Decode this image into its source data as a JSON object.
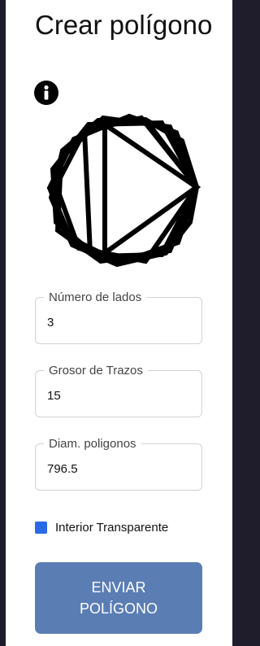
{
  "header": {
    "title": "Crear polígono",
    "info_icon": "info-circle-icon"
  },
  "form": {
    "sides": {
      "label": "Número de lados",
      "value": "3"
    },
    "stroke_width": {
      "label": "Grosor de Trazos",
      "value": "15"
    },
    "diameter": {
      "label": "Diam. poligonos",
      "value": "796.5"
    },
    "transparent_interior": {
      "label": "Interior Transparente",
      "checked": true
    },
    "submit_label": "ENVIAR POLÍGONO"
  },
  "colors": {
    "panel_background": "#ffffff",
    "page_background": "#1f1d2b",
    "checkbox_accent": "#2b6ae6",
    "submit_button": "#5a7db4",
    "polygon_stroke": "#000000"
  }
}
